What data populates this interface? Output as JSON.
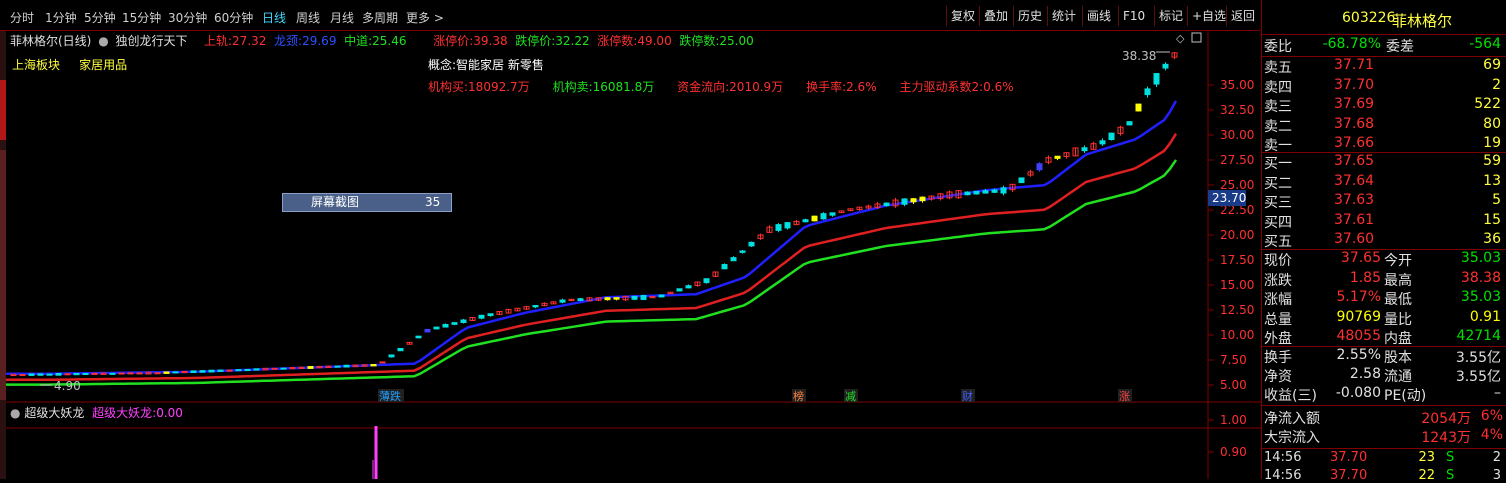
{
  "tabs": [
    "分时",
    "1分钟",
    "5分钟",
    "15分钟",
    "30分钟",
    "60分钟",
    "日线",
    "周线",
    "月线",
    "多周期",
    "更多 >"
  ],
  "active_tab": "日线",
  "toolbar": [
    "复权",
    "叠加",
    "历史",
    "统计",
    "画线",
    "F10",
    "标记",
    "+自选",
    "返回"
  ],
  "chart_header": {
    "stock": "菲林格尔(日线)",
    "indicator": "独创龙行天下",
    "upper_label": "上轨:",
    "upper_value": "27.32",
    "dragon_label": "龙颈:",
    "dragon_value": "29.69",
    "mid_label": "中道:",
    "mid_value": "25.46",
    "limit_up_label": "涨停价:",
    "limit_up_value": "39.38",
    "limit_down_label": "跌停价:",
    "limit_down_value": "32.22",
    "up_count_label": "涨停数:",
    "up_count_value": "49.00",
    "down_count_label": "跌停数:",
    "down_count_value": "25.00"
  },
  "sector": {
    "board": "上海板块",
    "industry": "家居用品"
  },
  "concept": "概念:智能家居 新零售",
  "flows": {
    "inst_buy": "机构买:18092.7万",
    "inst_sell": "机构卖:16081.8万",
    "fund_flow": "资金流向:2010.9万",
    "turnover": "换手率:2.6%",
    "driver": "主力驱动系数2:0.6%"
  },
  "popup": {
    "label": "屏幕截图",
    "value": "35"
  },
  "annotations": {
    "high": "38.38",
    "low": "4.90",
    "current_price_tag": "23.70"
  },
  "markers": [
    "薄跌",
    "榜",
    "减",
    "财",
    "涨"
  ],
  "lower_panel": {
    "name": "超级大妖龙",
    "label": "超级大妖龙:",
    "value": "0.00",
    "axis": [
      "1.00",
      "0.90"
    ]
  },
  "price_axis": [
    "35.00",
    "32.50",
    "30.00",
    "27.50",
    "25.00",
    "22.50",
    "20.00",
    "17.50",
    "15.00",
    "12.50",
    "10.00",
    "7.50",
    "5.00"
  ],
  "quote": {
    "code": "603226",
    "name": "菲林格尔",
    "weibi_label": "委比",
    "weibi": "-68.78%",
    "weicha_label": "委差",
    "weicha": "-564",
    "sells": [
      {
        "label": "卖五",
        "price": "37.71",
        "vol": "69"
      },
      {
        "label": "卖四",
        "price": "37.70",
        "vol": "2"
      },
      {
        "label": "卖三",
        "price": "37.69",
        "vol": "522"
      },
      {
        "label": "卖二",
        "price": "37.68",
        "vol": "80"
      },
      {
        "label": "卖一",
        "price": "37.66",
        "vol": "19"
      }
    ],
    "buys": [
      {
        "label": "买一",
        "price": "37.65",
        "vol": "59"
      },
      {
        "label": "买二",
        "price": "37.64",
        "vol": "13"
      },
      {
        "label": "买三",
        "price": "37.63",
        "vol": "5"
      },
      {
        "label": "买四",
        "price": "37.61",
        "vol": "15"
      },
      {
        "label": "买五",
        "price": "37.60",
        "vol": "36"
      }
    ],
    "stats": [
      {
        "l1": "现价",
        "v1": "37.65",
        "l2": "今开",
        "v2": "35.03",
        "c1": "#ff3030",
        "c2": "#00e000"
      },
      {
        "l1": "涨跌",
        "v1": "1.85",
        "l2": "最高",
        "v2": "38.38",
        "c1": "#ff3030",
        "c2": "#ff3030"
      },
      {
        "l1": "涨幅",
        "v1": "5.17%",
        "l2": "最低",
        "v2": "35.03",
        "c1": "#ff3030",
        "c2": "#00e000"
      },
      {
        "l1": "总量",
        "v1": "90769",
        "l2": "量比",
        "v2": "0.91",
        "c1": "#ffff00",
        "c2": "#ffff00"
      },
      {
        "l1": "外盘",
        "v1": "48055",
        "l2": "内盘",
        "v2": "42714",
        "c1": "#ff3030",
        "c2": "#00e000"
      }
    ],
    "stats2": [
      {
        "l1": "换手",
        "v1": "2.55%",
        "l2": "股本",
        "v2": "3.55亿"
      },
      {
        "l1": "净资",
        "v1": "2.58",
        "l2": "流通",
        "v2": "3.55亿"
      },
      {
        "l1": "收益(三)",
        "v1": "-0.080",
        "l2": "PE(动)",
        "v2": "–"
      }
    ],
    "netflow": {
      "label": "净流入额",
      "value": "2054万",
      "pct": "6%"
    },
    "blockflow": {
      "label": "大宗流入",
      "value": "1243万",
      "pct": "4%"
    },
    "ticks": [
      {
        "time": "14:56",
        "price": "37.70",
        "vol": "23",
        "dir": "S",
        "n": "2"
      },
      {
        "time": "14:56",
        "price": "37.70",
        "vol": "22",
        "dir": "S",
        "n": "3"
      }
    ]
  },
  "colors": {
    "up": "#ff3030",
    "down": "#00e000",
    "border": "#800000",
    "blue": "#2020ff",
    "red": "#ff2020",
    "green": "#20e020"
  }
}
